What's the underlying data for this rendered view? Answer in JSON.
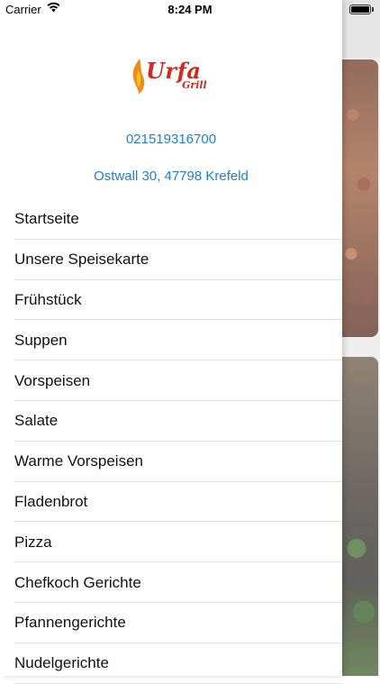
{
  "status_bar": {
    "carrier": "Carrier",
    "time": "8:24 PM",
    "wifi_icon": "wifi-icon",
    "battery_icon": "battery-icon",
    "battery_level": 1.0
  },
  "drawer": {
    "logo": {
      "name": "Urfa",
      "sub": "Grill",
      "color": "#d22a1e"
    },
    "phone": "021519316700",
    "address": "Ostwall 30, 47798 Krefeld",
    "link_color": "#1f7fd1",
    "menu": [
      {
        "label": "Startseite"
      },
      {
        "label": "Unsere Speisekarte"
      },
      {
        "label": "Frühstück"
      },
      {
        "label": "Suppen"
      },
      {
        "label": "Vorspeisen"
      },
      {
        "label": "Salate"
      },
      {
        "label": "Warme Vorspeisen"
      },
      {
        "label": "Fladenbrot"
      },
      {
        "label": "Pizza"
      },
      {
        "label": "Chefkoch Gerichte"
      },
      {
        "label": "Pfannengerichte"
      },
      {
        "label": "Nudelgerichte"
      }
    ]
  }
}
